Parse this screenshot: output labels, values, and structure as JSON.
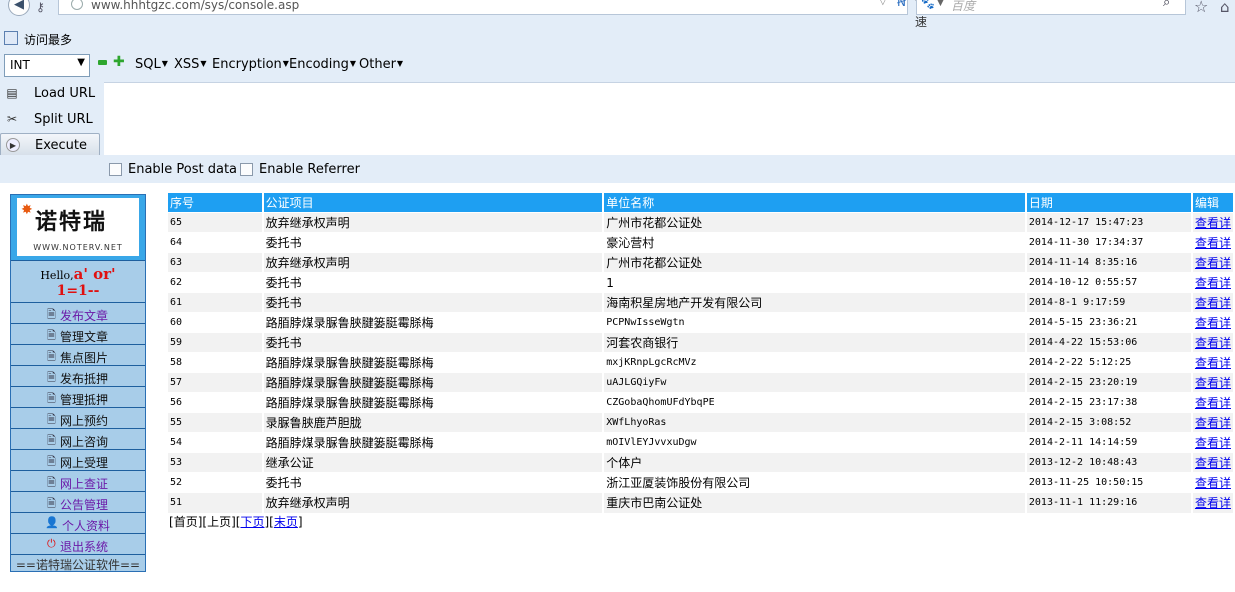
{
  "browser": {
    "url": "www.hhhtgzc.com/sys/console.asp",
    "speed_label": "高速",
    "search_placeholder": "百度"
  },
  "bookmarks": [
    {
      "label": "访问最多"
    }
  ],
  "hackbar": {
    "select_value": "INT",
    "menus": [
      {
        "label": "SQL"
      },
      {
        "label": "XSS"
      },
      {
        "label": "Encryption"
      },
      {
        "label": "Encoding"
      },
      {
        "label": "Other"
      }
    ],
    "buttons": {
      "load_url": "Load URL",
      "split_url": "Split URL",
      "execute": "Execute"
    },
    "post_data_label": "Enable Post data",
    "referrer_label": "Enable Referrer"
  },
  "sidebar": {
    "logo_text": "诺特瑞",
    "logo_sub": "WWW.NOTERV.NET",
    "hello_prefix": "Hello,",
    "hello_injection": "a' or'",
    "hello_injection_2": "1=1--",
    "items": [
      {
        "label": "发布文章",
        "icon": "document-icon"
      },
      {
        "label": "管理文章",
        "icon": "document-icon"
      },
      {
        "label": "焦点图片",
        "icon": "document-icon"
      },
      {
        "label": "发布抵押",
        "icon": "document-icon"
      },
      {
        "label": "管理抵押",
        "icon": "document-icon"
      },
      {
        "label": "网上预约",
        "icon": "document-icon"
      },
      {
        "label": "网上咨询",
        "icon": "document-icon"
      },
      {
        "label": "网上受理",
        "icon": "document-icon"
      },
      {
        "label": "网上查证",
        "icon": "document-icon"
      },
      {
        "label": "公告管理",
        "icon": "document-icon"
      },
      {
        "label": "个人资料",
        "icon": "user-icon"
      },
      {
        "label": "退出系统",
        "icon": "power-icon"
      }
    ],
    "footer": "==诺特瑞公证软件=="
  },
  "table": {
    "headers": [
      "序号",
      "公证项目",
      "单位名称",
      "日期",
      "编辑"
    ],
    "edit_label": "查看详",
    "rows": [
      {
        "id": "65",
        "item": "放弃继承权声明",
        "unit": "广州市花都公证处",
        "date": "2014-12-17 15:47:23"
      },
      {
        "id": "64",
        "item": "委托书",
        "unit": "豪沁营村",
        "date": "2014-11-30 17:34:37"
      },
      {
        "id": "63",
        "item": "放弃继承权声明",
        "unit": "广州市花都公证处",
        "date": "2014-11-14 8:35:16"
      },
      {
        "id": "62",
        "item": "委托书",
        "unit": "1",
        "date": "2014-10-12 0:55:57"
      },
      {
        "id": "61",
        "item": "委托书",
        "unit": "海南积星房地产开发有限公司",
        "date": "2014-8-1 9:17:59"
      },
      {
        "id": "60",
        "item": "路脜脖煤录脲鲁脥腱篓脡霉脎梅",
        "unit": "PCPNwIsseWgtn",
        "date": "2014-5-15 23:36:21"
      },
      {
        "id": "59",
        "item": "委托书",
        "unit": "河套农商银行",
        "date": "2014-4-22 15:53:06"
      },
      {
        "id": "58",
        "item": "路脜脖煤录脲鲁脥腱篓脡霉脎梅",
        "unit": "mxjKRnpLgcRcMVz",
        "date": "2014-2-22 5:12:25"
      },
      {
        "id": "57",
        "item": "路脜脖煤录脲鲁脥腱篓脡霉脎梅",
        "unit": "uAJLGQiyFw",
        "date": "2014-2-15 23:20:19"
      },
      {
        "id": "56",
        "item": "路脜脖煤录脲鲁脥腱篓脡霉脎梅",
        "unit": "CZGobaQhomUFdYbqPE",
        "date": "2014-2-15 23:17:38"
      },
      {
        "id": "55",
        "item": "录脲鲁脥鹿芦胆胧",
        "unit": "XWfLhyoRas",
        "date": "2014-2-15 3:08:52"
      },
      {
        "id": "54",
        "item": "路脜脖煤录脲鲁脥腱篓脡霉脎梅",
        "unit": "mOIVlEYJvvxuDgw",
        "date": "2014-2-11 14:14:59"
      },
      {
        "id": "53",
        "item": "继承公证",
        "unit": "个体户",
        "date": "2013-12-2 10:48:43"
      },
      {
        "id": "52",
        "item": "委托书",
        "unit": "浙江亚厦装饰股份有限公司",
        "date": "2013-11-25 10:50:15"
      },
      {
        "id": "51",
        "item": "放弃继承权声明",
        "unit": "重庆市巴南公证处",
        "date": "2013-11-1 11:29:16"
      }
    ]
  },
  "pager": {
    "first": "首页",
    "prev": "上页",
    "next": "下页",
    "last": "末页"
  }
}
